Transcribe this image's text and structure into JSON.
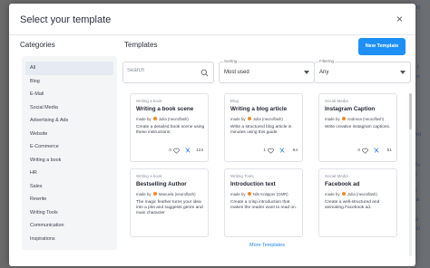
{
  "background": {
    "left_fragments": [
      "",
      "",
      "",
      ""
    ],
    "right_fragments": [
      "ashi",
      "ite t",
      "le w",
      "w",
      "'t wo",
      "ur",
      "ll, fo",
      "les",
      "ive",
      "dea",
      "tyle",
      "fash",
      "ye"
    ]
  },
  "modal": {
    "title": "Select your template",
    "close_label": "×"
  },
  "categories": {
    "heading": "Categories",
    "items": [
      "All",
      "Blog",
      "E-Mail",
      "Social Media",
      "Advertising & Ads",
      "Website",
      "E-Commerce",
      "Writing a book",
      "HR",
      "Sales",
      "Rewrite",
      "Writing Tools",
      "Communication",
      "Inspirations"
    ],
    "active_index": 0
  },
  "templates": {
    "heading": "Templates",
    "new_button": "New Template",
    "search_placeholder": "Search",
    "sorting": {
      "label": "Sorting",
      "value": "Most used"
    },
    "filtering": {
      "label": "Filtering",
      "value": "Any"
    },
    "more_button": "More Templates",
    "cards": [
      {
        "category": "Writing a book",
        "title": "Writing a book scene",
        "made_by": "made by",
        "author": "Julia (neuroflash)",
        "description": "Create a detailed book scene using these instructions.",
        "likes": "0",
        "uses": "123"
      },
      {
        "category": "Blog",
        "title": "Writing a blog article",
        "made_by": "made by",
        "author": "Julia (neuroflash)",
        "description": "Write a structured blog article in minutes using this guide.",
        "likes": "1",
        "uses": "64"
      },
      {
        "category": "Social Media",
        "title": "Instagram Caption",
        "made_by": "made by",
        "author": "Andreea (neuroflash)",
        "description": "Write creative instagram captions.",
        "likes": "0",
        "uses": "51"
      },
      {
        "category": "Writing a book",
        "title": "Bestselling Author",
        "made_by": "made by",
        "author": "Manuela (neuroflash)",
        "description": "The magic feather turns your idea into a plot and suggests genre and main character",
        "likes": "",
        "uses": ""
      },
      {
        "category": "Writing Tools",
        "title": "Introduction text",
        "made_by": "made by",
        "author": "Nils Knäpper (OMR)",
        "description": "Create a crisp introduction that makes the reader want to read on.",
        "likes": "",
        "uses": ""
      },
      {
        "category": "Social Media",
        "title": "Facebook ad",
        "made_by": "made by",
        "author": "Julia (neuroflash)",
        "description": "Create a well-structured and animating Facebook ad.",
        "likes": "",
        "uses": ""
      }
    ]
  },
  "colors": {
    "accent": "#1e90f5",
    "link": "#1e88e5",
    "overlay": "#6e6e6e"
  }
}
